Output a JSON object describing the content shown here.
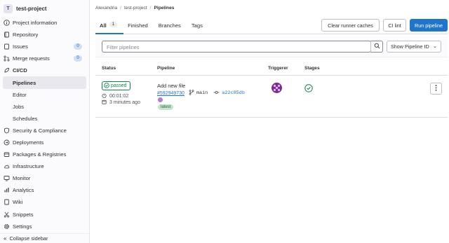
{
  "sidebar": {
    "avatar_letter": "T",
    "project_name": "test-project",
    "items": [
      {
        "label": "Project information",
        "icon": "info-icon"
      },
      {
        "label": "Repository",
        "icon": "repository-icon"
      },
      {
        "label": "Issues",
        "icon": "issues-icon",
        "badge": "0"
      },
      {
        "label": "Merge requests",
        "icon": "merge-request-icon",
        "badge": "0"
      },
      {
        "label": "CI/CD",
        "icon": "rocket-icon"
      },
      {
        "label": "Pipelines"
      },
      {
        "label": "Editor"
      },
      {
        "label": "Jobs"
      },
      {
        "label": "Schedules"
      },
      {
        "label": "Security & Compliance",
        "icon": "shield-icon"
      },
      {
        "label": "Deployments",
        "icon": "deployments-icon"
      },
      {
        "label": "Packages & Registries",
        "icon": "package-icon"
      },
      {
        "label": "Infrastructure",
        "icon": "cloud-icon"
      },
      {
        "label": "Monitor",
        "icon": "monitor-icon"
      },
      {
        "label": "Analytics",
        "icon": "chart-icon"
      },
      {
        "label": "Wiki",
        "icon": "book-icon"
      },
      {
        "label": "Snippets",
        "icon": "scissors-icon"
      },
      {
        "label": "Settings",
        "icon": "gear-icon"
      }
    ],
    "collapse_label": "Collapse sidebar"
  },
  "breadcrumb": {
    "items": [
      "Alexandria",
      "test-project",
      "Pipelines"
    ]
  },
  "tabs": [
    {
      "label": "All",
      "count": "1"
    },
    {
      "label": "Finished"
    },
    {
      "label": "Branches"
    },
    {
      "label": "Tags"
    }
  ],
  "buttons": {
    "clear_cache": "Clear runner caches",
    "ci_lint": "CI lint",
    "run_pipeline": "Run pipeline"
  },
  "filter": {
    "placeholder": "Filter pipelines",
    "sort_label": "Show Pipeline ID"
  },
  "table": {
    "headers": [
      "Status",
      "Pipeline",
      "Triggerer",
      "Stages"
    ],
    "row": {
      "status": "passed",
      "duration": "00:01:02",
      "time_ago": "3 minutes ago",
      "title": "Add new file",
      "pipeline_id": "#592949730",
      "branch": "main",
      "commit": "a22c85db",
      "tag": "latest"
    }
  },
  "colors": {
    "accent": "#1f75cb",
    "success": "#108548",
    "sidebar_bg": "#fbfafd"
  }
}
